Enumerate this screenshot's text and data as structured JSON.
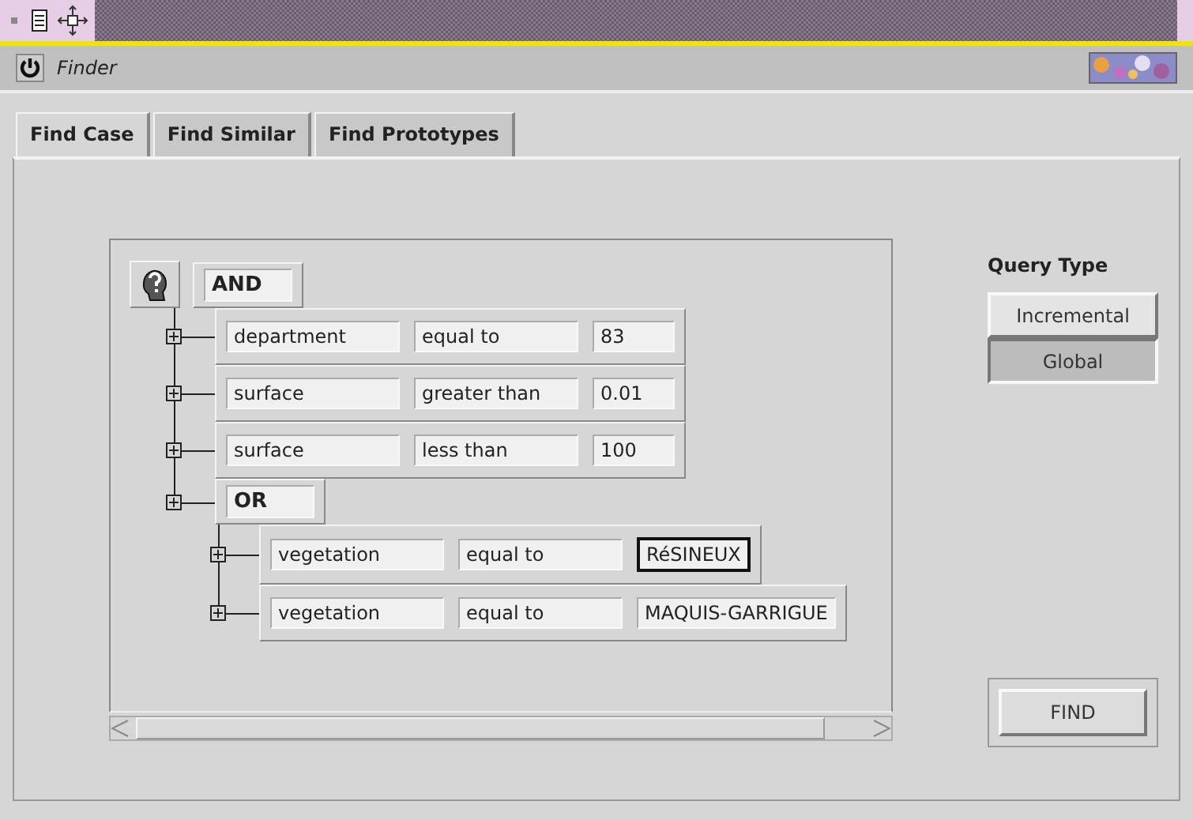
{
  "window": {
    "title": "Finder"
  },
  "tabs": [
    {
      "label": "Find Case",
      "selected": true
    },
    {
      "label": "Find Similar",
      "selected": false
    },
    {
      "label": "Find Prototypes",
      "selected": false
    }
  ],
  "query": {
    "operator": "AND",
    "children": [
      {
        "kind": "condition",
        "attribute": "department",
        "relation": "equal to",
        "value": "83",
        "focused": false
      },
      {
        "kind": "condition",
        "attribute": "surface",
        "relation": "greater than",
        "value": "0.01",
        "focused": false
      },
      {
        "kind": "condition",
        "attribute": "surface",
        "relation": "less than",
        "value": "100",
        "focused": false
      },
      {
        "kind": "group",
        "operator": "OR",
        "children": [
          {
            "kind": "condition",
            "attribute": "vegetation",
            "relation": "equal to",
            "value": "RéSINEUX",
            "focused": true
          },
          {
            "kind": "condition",
            "attribute": "vegetation",
            "relation": "equal to",
            "value": "MAQUIS-GARRIGUE",
            "focused": false
          }
        ]
      }
    ]
  },
  "query_type": {
    "label": "Query Type",
    "options": [
      {
        "label": "Incremental",
        "selected": false
      },
      {
        "label": "Global",
        "selected": true
      }
    ]
  },
  "find_button": "FIND"
}
